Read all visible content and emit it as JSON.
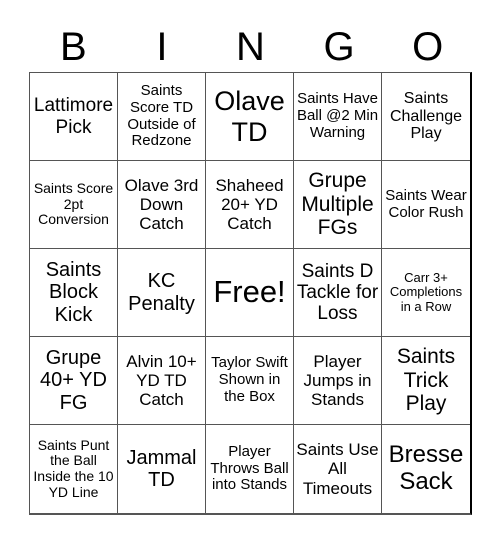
{
  "card": {
    "header": [
      "B",
      "I",
      "N",
      "G",
      "O"
    ],
    "cells": [
      "Lattimore Pick",
      "Saints Score TD Outside of Redzone",
      "Olave TD",
      "Saints Have Ball @2 Min Warning",
      "Saints Challenge Play",
      "Saints Score 2pt Conversion",
      "Olave 3rd Down Catch",
      "Shaheed 20+ YD Catch",
      "Grupe Multiple FGs",
      "Saints Wear Color Rush",
      "Saints Block Kick",
      "KC Penalty",
      "Free!",
      "Saints D Tackle for Loss",
      "Carr 3+ Completions in a Row",
      "Grupe 40+ YD FG",
      "Alvin 10+ YD TD Catch",
      "Taylor Swift Shown in the Box",
      "Player Jumps in Stands",
      "Saints Trick Play",
      "Saints Punt the Ball Inside the 10 YD Line",
      "Jammal TD",
      "Player Throws Ball into Stands",
      "Saints Use All Timeouts",
      "Bresse Sack"
    ],
    "free_space_index": 12
  }
}
